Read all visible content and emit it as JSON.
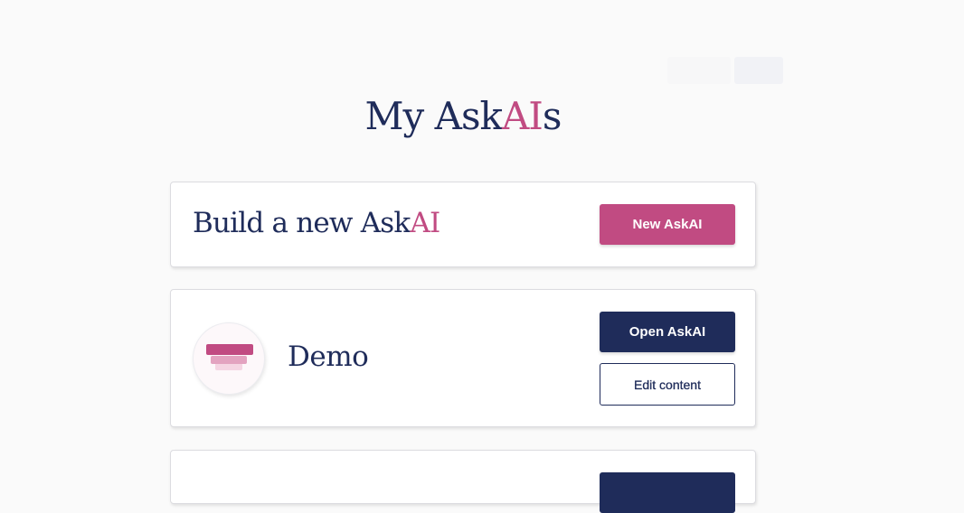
{
  "page": {
    "title_main": "My Ask",
    "title_accent": "AI",
    "title_suffix": "s"
  },
  "build_card": {
    "title_main": "Build a new Ask",
    "title_accent": "AI",
    "new_button_label": "New AskAI"
  },
  "askais": [
    {
      "name": "Demo",
      "icon": "layered-stack-icon",
      "open_button_label": "Open AskAI",
      "edit_button_label": "Edit content"
    }
  ],
  "colors": {
    "navy": "#1f2c5a",
    "accent_pink": "#c14b82",
    "background": "#fafafa"
  }
}
